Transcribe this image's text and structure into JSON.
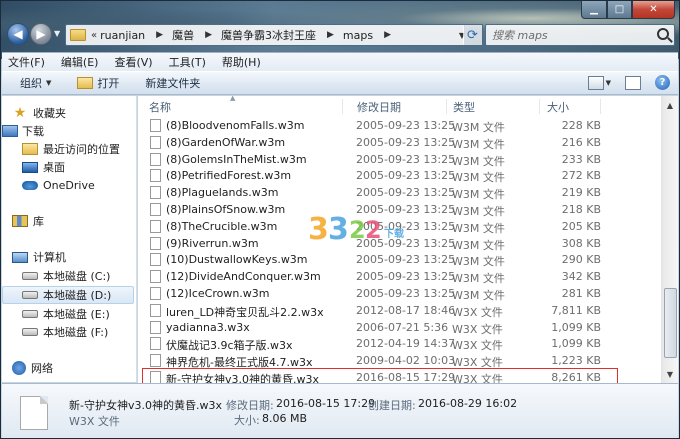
{
  "address": {
    "crumbs": [
      "ruanjian",
      "魔兽",
      "魔兽争霸3冰封王座",
      "maps"
    ],
    "prefix": "«"
  },
  "search": {
    "placeholder": "搜索 maps"
  },
  "menu": [
    "文件(F)",
    "编辑(E)",
    "查看(V)",
    "工具(T)",
    "帮助(H)"
  ],
  "toolbar": {
    "organize": "组织",
    "open": "打开",
    "new_folder": "新建文件夹"
  },
  "nav": {
    "favorites": "收藏夹",
    "downloads": "下载",
    "recent": "最近访问的位置",
    "desktop": "桌面",
    "onedrive": "OneDrive",
    "libraries": "库",
    "computer": "计算机",
    "drives": [
      "本地磁盘 (C:)",
      "本地磁盘 (D:)",
      "本地磁盘 (E:)",
      "本地磁盘 (F:)"
    ],
    "network": "网络"
  },
  "columns": {
    "name": "名称",
    "date": "修改日期",
    "type": "类型",
    "size": "大小"
  },
  "files": [
    {
      "name": "(8)BloodvenomFalls.w3m",
      "date": "2005-09-23 13:25",
      "type": "W3M 文件",
      "size": "228 KB"
    },
    {
      "name": "(8)GardenOfWar.w3m",
      "date": "2005-09-23 13:25",
      "type": "W3M 文件",
      "size": "216 KB"
    },
    {
      "name": "(8)GolemsInTheMist.w3m",
      "date": "2005-09-23 13:25",
      "type": "W3M 文件",
      "size": "233 KB"
    },
    {
      "name": "(8)PetrifiedForest.w3m",
      "date": "2005-09-23 13:25",
      "type": "W3M 文件",
      "size": "272 KB"
    },
    {
      "name": "(8)Plaguelands.w3m",
      "date": "2005-09-23 13:25",
      "type": "W3M 文件",
      "size": "219 KB"
    },
    {
      "name": "(8)PlainsOfSnow.w3m",
      "date": "2005-09-23 13:25",
      "type": "W3M 文件",
      "size": "218 KB"
    },
    {
      "name": "(8)TheCrucible.w3m",
      "date": "2005-09-23 13:25",
      "type": "W3M 文件",
      "size": "205 KB"
    },
    {
      "name": "(9)Riverrun.w3m",
      "date": "2005-09-23 13:25",
      "type": "W3M 文件",
      "size": "308 KB"
    },
    {
      "name": "(10)DustwallowKeys.w3m",
      "date": "2005-09-23 13:25",
      "type": "W3M 文件",
      "size": "290 KB"
    },
    {
      "name": "(12)DivideAndConquer.w3m",
      "date": "2005-09-23 13:25",
      "type": "W3M 文件",
      "size": "342 KB"
    },
    {
      "name": "(12)IceCrown.w3m",
      "date": "2005-09-23 13:25",
      "type": "W3M 文件",
      "size": "281 KB"
    },
    {
      "name": "luren_LD神奇宝贝乱斗2.2.w3x",
      "date": "2012-08-17 18:46",
      "type": "W3X 文件",
      "size": "7,811 KB"
    },
    {
      "name": "yadianna3.w3x",
      "date": "2006-07-21 5:36",
      "type": "W3X 文件",
      "size": "1,099 KB"
    },
    {
      "name": "伏魔战记3.9c箱子版.w3x",
      "date": "2012-04-19 14:37",
      "type": "W3X 文件",
      "size": "1,099 KB"
    },
    {
      "name": "神界危机-最终正式版4.7.w3x",
      "date": "2009-04-02 10:03",
      "type": "W3X 文件",
      "size": "1,223 KB"
    },
    {
      "name": "新-守护女神v3.0神的黄昏.w3x",
      "date": "2016-08-15 17:29",
      "type": "W3X 文件",
      "size": "8,261 KB"
    }
  ],
  "details": {
    "name": "新-守护女神v3.0神的黄昏.w3x",
    "type": "W3X 文件",
    "modified_label": "修改日期:",
    "modified": "2016-08-15 17:29",
    "created_label": "创建日期:",
    "created": "2016-08-29 16:02",
    "size_label": "大小:",
    "size": "8.06 MB"
  },
  "watermark": {
    "d1": "3",
    "d2": "3",
    "d3": "2",
    "d4": "2",
    "suffix": "下载"
  }
}
